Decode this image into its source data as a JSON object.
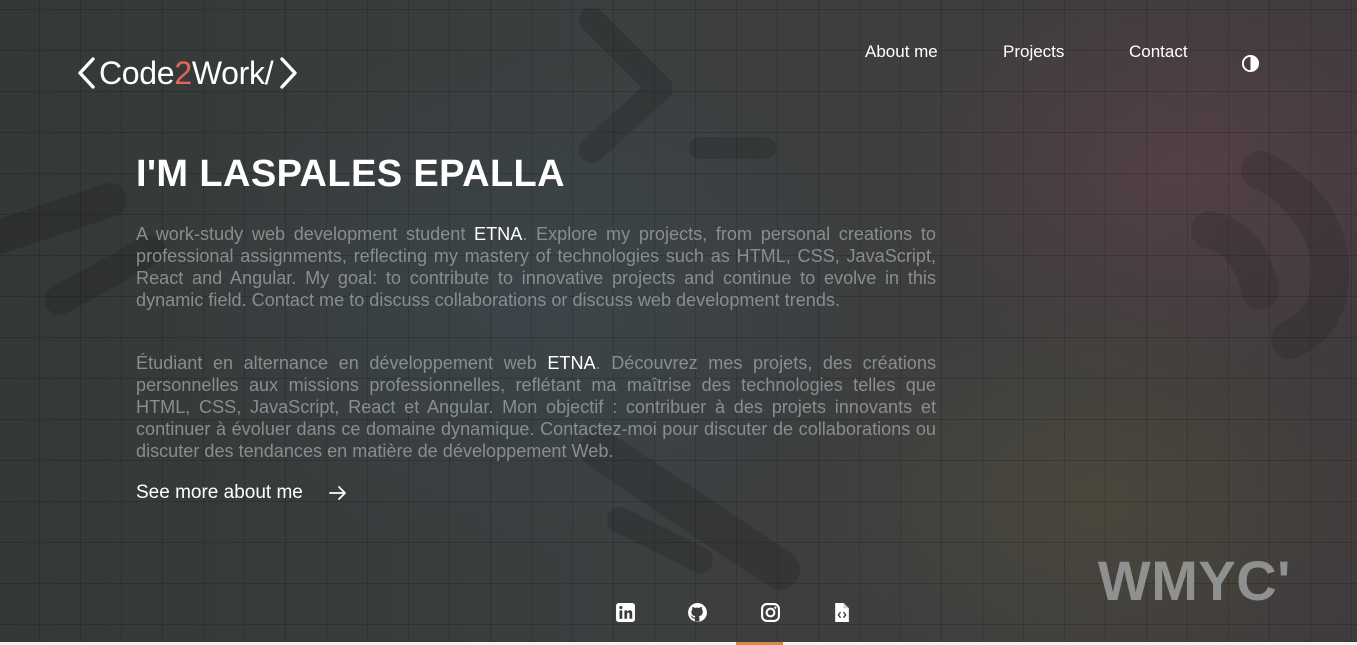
{
  "brand": {
    "prefix": "Code",
    "accent": "2",
    "suffix": "Work/",
    "accent_color": "#e2665a"
  },
  "nav": {
    "items": [
      {
        "label": "About me"
      },
      {
        "label": "Projects"
      },
      {
        "label": "Contact"
      }
    ],
    "theme_toggle_icon": "contrast-icon"
  },
  "hero": {
    "title": "I'M LASPALES EPALLA",
    "para_en": {
      "before": "A work-study web development student ",
      "highlight": "ETNA",
      "after": ". Explore my projects, from personal creations to professional assignments, reflecting my mastery of technologies such as HTML, CSS, JavaScript, React and Angular. My goal: to contribute to innovative projects and continue to evolve in this dynamic field. Contact me to discuss collaborations or discuss web development trends."
    },
    "para_fr": {
      "before": "Étudiant en alternance en développement web ",
      "highlight": "ETNA",
      "after": ". Découvrez mes projets, des créations personnelles aux missions professionnelles, reflétant ma maîtrise des technologies telles que HTML, CSS, JavaScript, React et Angular. Mon objectif : contribuer à des projets innovants et continuer à évoluer dans ce domaine dynamique. Contactez-moi pour discuter de collaborations ou discuter des tendances en matière de développement Web."
    },
    "cta_label": "See more about me",
    "cta_icon": "arrow-right-icon"
  },
  "watermark": "WMYC'",
  "socials": [
    {
      "icon": "linkedin-icon"
    },
    {
      "icon": "github-icon"
    },
    {
      "icon": "instagram-icon"
    },
    {
      "icon": "code-file-icon"
    }
  ],
  "colors": {
    "background": "#3a3c3c",
    "text": "#ffffff",
    "muted_text": "#8a8d8e",
    "watermark": "#8f9190"
  }
}
